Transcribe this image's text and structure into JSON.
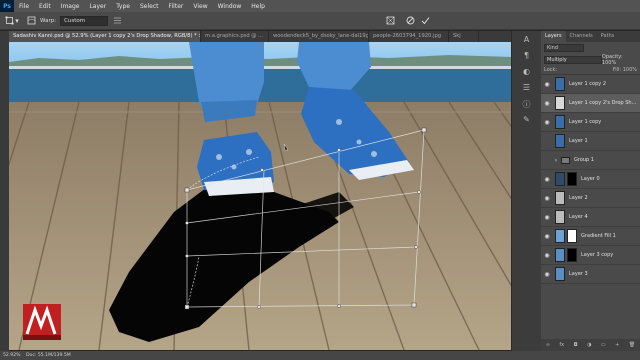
{
  "app": {
    "logo": "Ps"
  },
  "menu": [
    "File",
    "Edit",
    "Image",
    "Layer",
    "Type",
    "Select",
    "Filter",
    "View",
    "Window",
    "Help"
  ],
  "options_bar": {
    "warp_label": "Warp:",
    "warp_value": "Custom"
  },
  "tabs": [
    {
      "label": "Sadashiv Kanni.psd @ 52.9% (Layer 1 copy 2's Drop Shadow, RGB/8) * ×",
      "active": true
    },
    {
      "label": "m.a.graphics.psd @ ...",
      "active": false
    },
    {
      "label": "woodendeck5_by_dsoky_lane-dal19gh.jpeg",
      "active": false
    },
    {
      "label": "people-2603794_1920.jpg",
      "active": false
    },
    {
      "label": "Skj",
      "active": false
    }
  ],
  "panel": {
    "tabs": [
      "Layers",
      "Channels",
      "Paths"
    ],
    "kind_label": "Kind",
    "blend_mode": "Multiply",
    "opacity_label": "Opacity: 100%",
    "lock_label": "Lock:",
    "fill_label": "Fill: 100%",
    "layers": [
      {
        "name": "Layer 1 copy 2",
        "selected": false,
        "visible": true,
        "thumb": "#3a6ea8"
      },
      {
        "name": "Layer 1 copy 2's Drop Sh...",
        "selected": true,
        "visible": true,
        "thumb": "#d8d8d8"
      },
      {
        "name": "Layer 1 copy",
        "selected": false,
        "visible": true,
        "thumb": "#3a6ea8"
      },
      {
        "name": "Layer 1",
        "selected": false,
        "visible": false,
        "thumb": "#3a6ea8"
      },
      {
        "name": "Group 1",
        "selected": false,
        "visible": false,
        "thumb": "#7a7a7a"
      },
      {
        "name": "Layer 0",
        "selected": false,
        "visible": true,
        "thumb": "#2f4a6a"
      },
      {
        "name": "Layer 2",
        "selected": false,
        "visible": true,
        "thumb": "#bcbcbc"
      },
      {
        "name": "Layer 4",
        "selected": false,
        "visible": true,
        "thumb": "#bcbcbc"
      },
      {
        "name": "Gradient Fill 1",
        "selected": false,
        "visible": true,
        "thumb": "#6fa3d8"
      },
      {
        "name": "Layer 3 copy",
        "selected": false,
        "visible": true,
        "thumb": "#5a8fc4"
      },
      {
        "name": "Layer 3",
        "selected": false,
        "visible": true,
        "thumb": "#5a8fc4"
      }
    ]
  },
  "status": {
    "zoom": "52.92%",
    "doc": "Doc: 55.1M/139.5M"
  },
  "colors": {
    "sky": "#8ec8f0",
    "sea": "#2f6e9a",
    "deck": "#a59276",
    "shadow": "#050505",
    "shoe": "#2d6fc0",
    "jeans": "#4b8dd0"
  }
}
